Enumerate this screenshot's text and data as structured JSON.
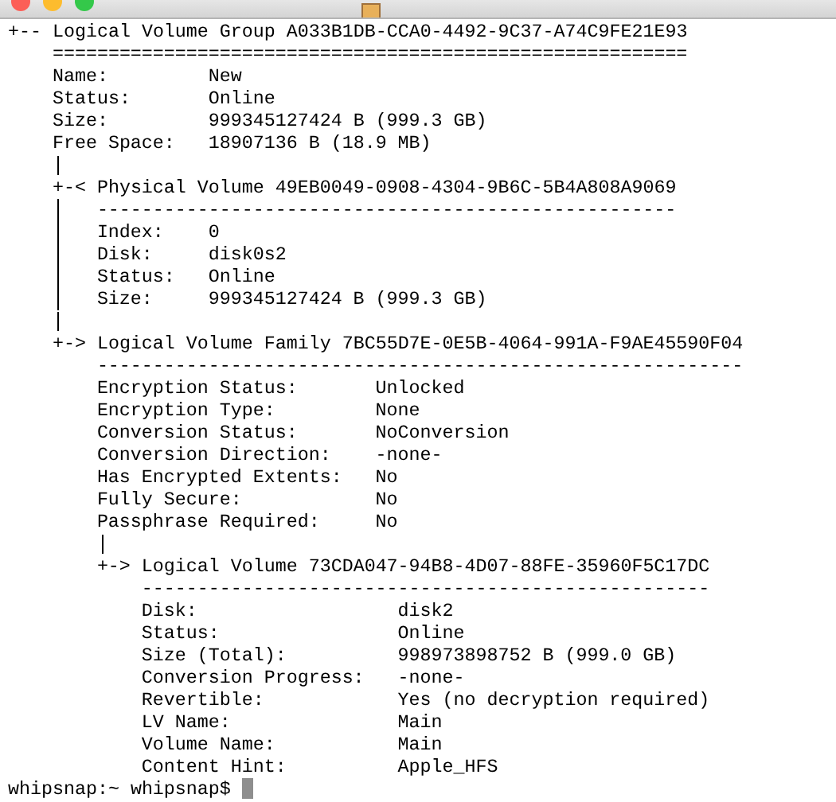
{
  "terminal": {
    "tree": {
      "branch": "+--",
      "header": "Logical Volume Group A033B1DB-CCA0-4492-9C37-A74C9FE21E93",
      "rule": "=========================================================",
      "fields": [
        {
          "label": "Name:",
          "value": "New"
        },
        {
          "label": "Status:",
          "value": "Online"
        },
        {
          "label": "Size:",
          "value": "999345127424 B (999.3 GB)"
        },
        {
          "label": "Free Space:",
          "value": "18907136 B (18.9 MB)"
        }
      ],
      "children": [
        {
          "branch": "+-<",
          "header": "Physical Volume 49EB0049-0908-4304-9B6C-5B4A808A9069",
          "rule": "----------------------------------------------------",
          "fields": [
            {
              "label": "Index:",
              "value": "0"
            },
            {
              "label": "Disk:",
              "value": "disk0s2"
            },
            {
              "label": "Status:",
              "value": "Online"
            },
            {
              "label": "Size:",
              "value": "999345127424 B (999.3 GB)"
            }
          ]
        },
        {
          "branch": "+->",
          "header": "Logical Volume Family 7BC55D7E-0E5B-4064-991A-F9AE45590F04",
          "rule": "----------------------------------------------------------",
          "fields": [
            {
              "label": "Encryption Status:",
              "value": "Unlocked"
            },
            {
              "label": "Encryption Type:",
              "value": "None"
            },
            {
              "label": "Conversion Status:",
              "value": "NoConversion"
            },
            {
              "label": "Conversion Direction:",
              "value": "-none-"
            },
            {
              "label": "Has Encrypted Extents:",
              "value": "No"
            },
            {
              "label": "Fully Secure:",
              "value": "No"
            },
            {
              "label": "Passphrase Required:",
              "value": "No"
            }
          ],
          "children": [
            {
              "branch": "+->",
              "header": "Logical Volume 73CDA047-94B8-4D07-88FE-35960F5C17DC",
              "rule": "---------------------------------------------------",
              "fields": [
                {
                  "label": "Disk:",
                  "value": "disk2"
                },
                {
                  "label": "Status:",
                  "value": "Online"
                },
                {
                  "label": "Size (Total):",
                  "value": "998973898752 B (999.0 GB)"
                },
                {
                  "label": "Conversion Progress:",
                  "value": "-none-"
                },
                {
                  "label": "Revertible:",
                  "value": "Yes (no decryption required)"
                },
                {
                  "label": "LV Name:",
                  "value": "Main"
                },
                {
                  "label": "Volume Name:",
                  "value": "Main"
                },
                {
                  "label": "Content Hint:",
                  "value": "Apple_HFS"
                }
              ]
            }
          ]
        }
      ]
    },
    "prompt": "whipsnap:~ whipsnap$"
  }
}
